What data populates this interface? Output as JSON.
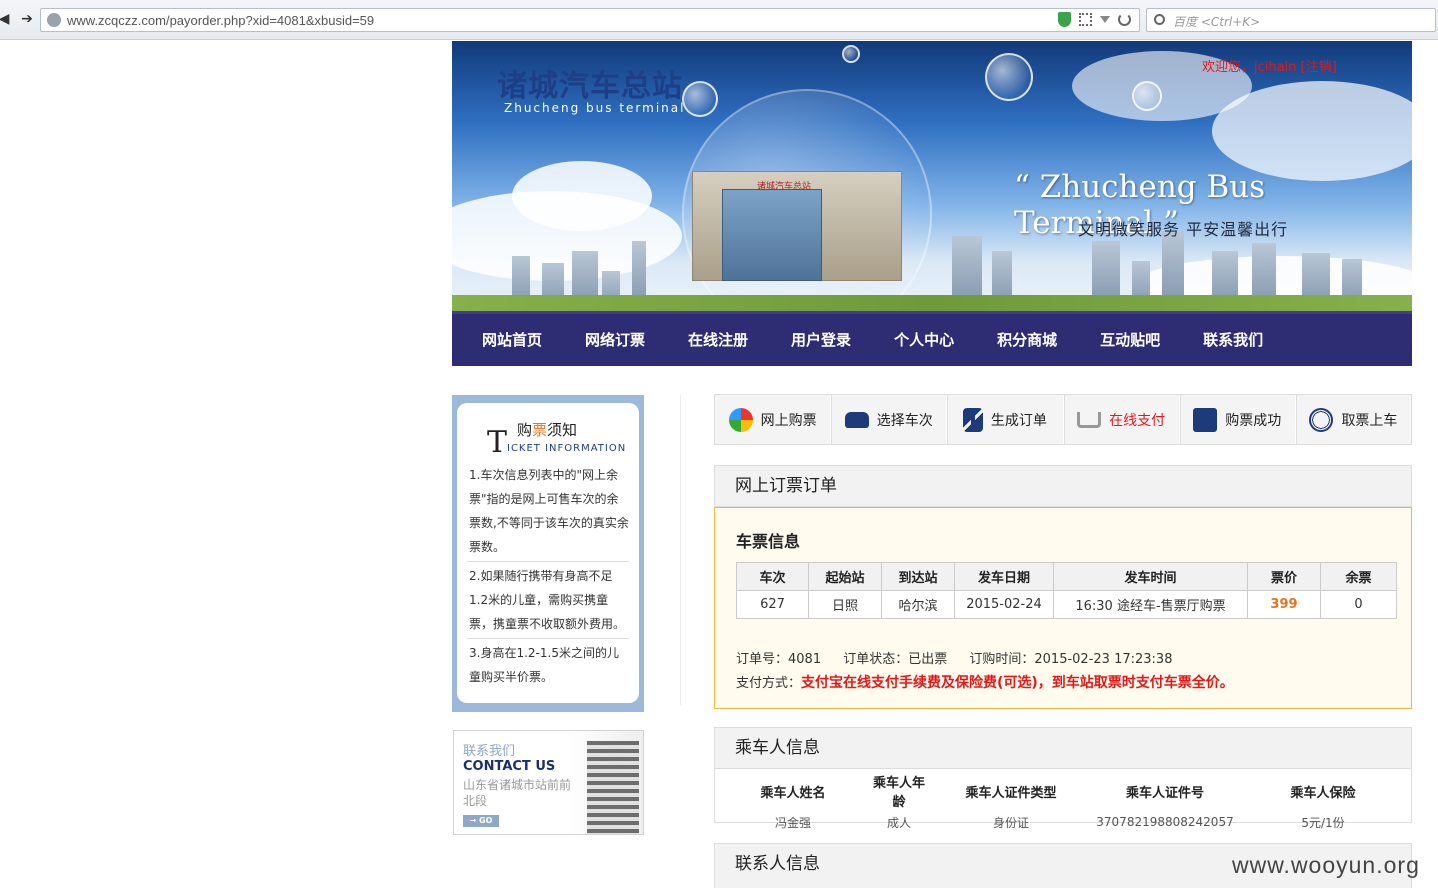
{
  "browser": {
    "url": "www.zcqczz.com/payorder.php?xid=4081&xbusid=59",
    "search_placeholder": "百度 <Ctrl+K>"
  },
  "banner": {
    "title_cn": "诸城汽车总站",
    "title_en": "Zhucheng bus terminal",
    "user_welcome": "欢迎您，jcihain [注销]",
    "building_sign": "诸城汽车总站",
    "slogan_en": "“ Zhucheng Bus Terminal ”",
    "slogan_cn": "文明微笑服务 平安温馨出行"
  },
  "nav": {
    "items": [
      "网站首页",
      "网络订票",
      "在线注册",
      "用户登录",
      "个人中心",
      "积分商城",
      "互动贴吧",
      "联系我们"
    ]
  },
  "notice": {
    "title_T": "T",
    "title_cn_a": "购",
    "title_cn_hl": "票",
    "title_cn_b": "须知",
    "title_en": "ICKET INFORMATION",
    "items": [
      "1.车次信息列表中的\"网上余票\"指的是网上可售车次的余票数,不等同于该车次的真实余票数。",
      "2.如果随行携带有身高不足1.2米的儿童，需购买携童票，携童票不收取额外费用。",
      "3.身高在1.2-1.5米之间的儿童购买半价票。"
    ]
  },
  "contact_box": {
    "title_cn": "联系我们",
    "title_en": "CONTACT US",
    "address": "山东省诸城市站前前北段",
    "go_label": "→ GO"
  },
  "steps": {
    "items": [
      "网上购票",
      "选择车次",
      "生成订单",
      "在线支付",
      "购票成功",
      "取票上车"
    ],
    "active_index": 3
  },
  "order": {
    "header": "网上订票订单",
    "ticket_title": "车票信息",
    "columns": [
      "车次",
      "起始站",
      "到达站",
      "发车日期",
      "发车时间",
      "票价",
      "余票"
    ],
    "row": [
      "627",
      "日照",
      "哈尔滨",
      "2015-02-24",
      "16:30 途经车-售票厅购票",
      "399",
      "0"
    ],
    "order_no": "订单号：4081",
    "order_status": "订单状态：已出票",
    "order_time": "订购时间：2015-02-23 17:23:38",
    "pay_label": "支付方式：",
    "pay_note": "支付宝在线支付手续费及保险费(可选)，到车站取票时支付车票全价。"
  },
  "passenger": {
    "header": "乘车人信息",
    "columns": [
      "乘车人姓名",
      "乘车人年龄",
      "乘车人证件类型",
      "乘车人证件号",
      "乘车人保险"
    ],
    "row": [
      "冯金强",
      "成人",
      "身份证",
      "370782198808242057",
      "5元/1份"
    ]
  },
  "contact_info": {
    "header": "联系人信息"
  },
  "watermark": "www.wooyun.org",
  "colors": {
    "nav_bg": "#2e2c73",
    "accent_red": "#e21919",
    "price_orange": "#e87418",
    "order_border": "#f2b646"
  }
}
